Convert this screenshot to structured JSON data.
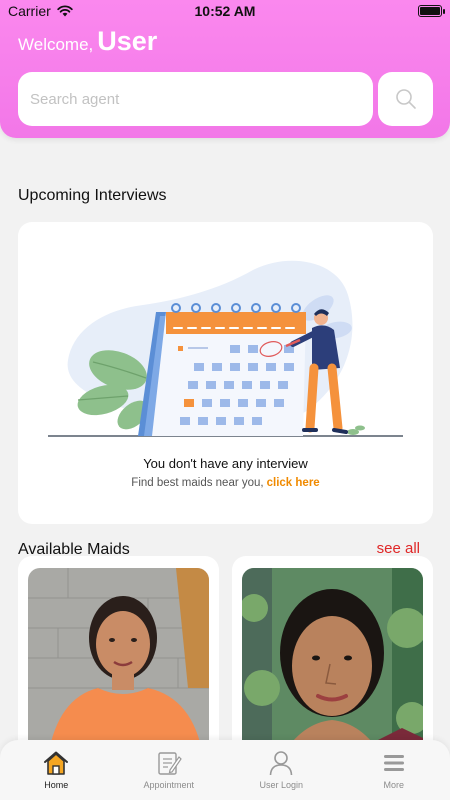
{
  "status_bar": {
    "carrier": "Carrier",
    "time": "10:52 AM"
  },
  "header": {
    "welcome_label": "Welcome,",
    "user_name": "User",
    "search_placeholder": "Search agent",
    "search_value": ""
  },
  "upcoming": {
    "title": "Upcoming Interviews",
    "empty_message": "You don't have any interview",
    "find_text": "Find best maids near you,",
    "click_here": "click here"
  },
  "maids": {
    "title": "Available Maids",
    "see_all": "see all",
    "items": [
      {
        "photo": "maid-photo-1"
      },
      {
        "photo": "maid-photo-2"
      }
    ]
  },
  "nav": {
    "items": [
      {
        "label": "Home",
        "icon": "home-icon",
        "active": true
      },
      {
        "label": "Appointment",
        "icon": "appointment-icon",
        "active": false
      },
      {
        "label": "User Login",
        "icon": "user-icon",
        "active": false
      },
      {
        "label": "More",
        "icon": "menu-icon",
        "active": false
      }
    ]
  },
  "colors": {
    "header_pink": "#f277e8",
    "link_orange": "#f08a00",
    "see_all_red": "#e02727",
    "home_active": "#f5a623"
  }
}
